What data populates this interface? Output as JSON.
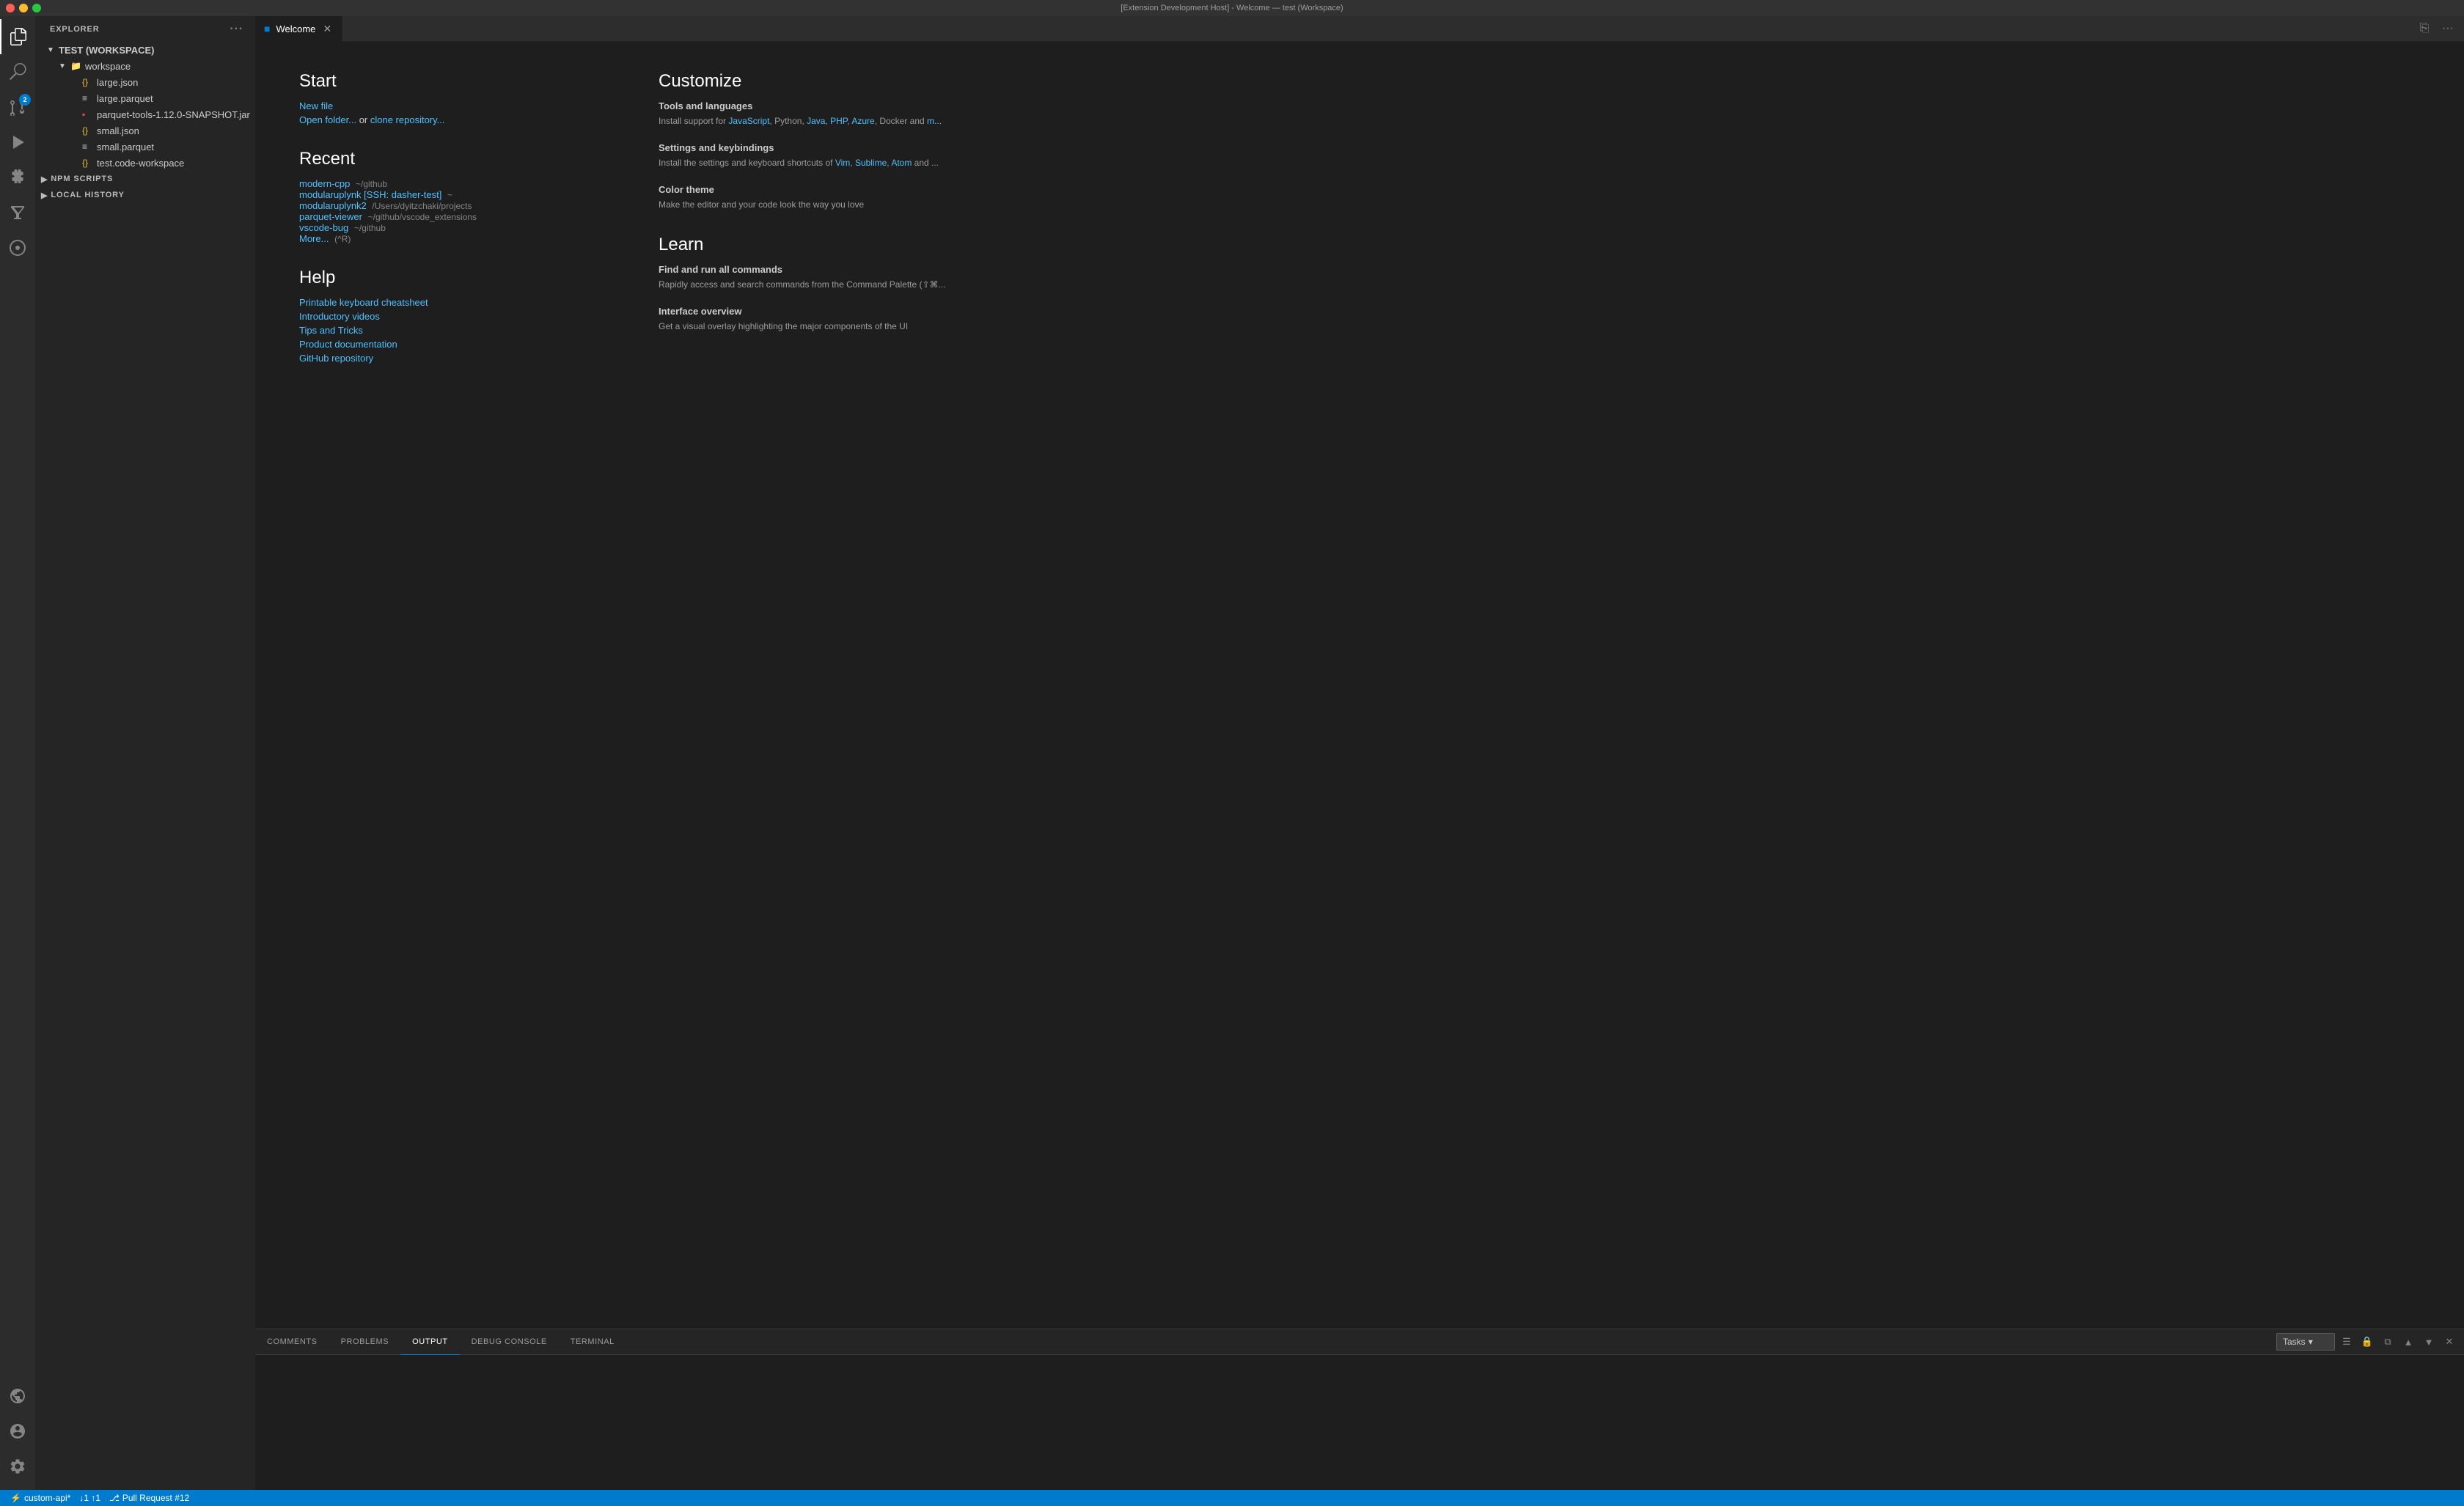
{
  "titlebar": {
    "title": "[Extension Development Host] - Welcome — test (Workspace)"
  },
  "activitybar": {
    "icons": [
      {
        "name": "explorer-icon",
        "symbol": "⎗",
        "active": true,
        "badge": null
      },
      {
        "name": "search-icon",
        "symbol": "🔍",
        "active": false,
        "badge": null
      },
      {
        "name": "source-control-icon",
        "symbol": "⎇",
        "active": false,
        "badge": "2"
      },
      {
        "name": "run-icon",
        "symbol": "▷",
        "active": false,
        "badge": null
      },
      {
        "name": "extensions-icon",
        "symbol": "⊞",
        "active": false,
        "badge": null
      },
      {
        "name": "testing-icon",
        "symbol": "⚗",
        "active": false,
        "badge": null
      },
      {
        "name": "git-graph-icon",
        "symbol": "◎",
        "active": false,
        "badge": null
      },
      {
        "name": "remote-icon",
        "symbol": "⊕",
        "active": false,
        "badge": null
      }
    ],
    "bottom": [
      {
        "name": "account-icon",
        "symbol": "👤"
      },
      {
        "name": "settings-icon",
        "symbol": "⚙"
      }
    ]
  },
  "sidebar": {
    "title": "EXPLORER",
    "workspace": {
      "label": "TEST (WORKSPACE)",
      "children": [
        {
          "label": "workspace",
          "expanded": true,
          "children": [
            {
              "label": "large.json",
              "type": "json"
            },
            {
              "label": "large.parquet",
              "type": "parquet"
            },
            {
              "label": "parquet-tools-1.12.0-SNAPSHOT.jar",
              "type": "jar"
            },
            {
              "label": "small.json",
              "type": "json"
            },
            {
              "label": "small.parquet",
              "type": "parquet"
            },
            {
              "label": "test.code-workspace",
              "type": "workspace"
            }
          ]
        }
      ]
    },
    "sections": [
      {
        "label": "NPM SCRIPTS"
      },
      {
        "label": "LOCAL HISTORY"
      }
    ]
  },
  "tabs": [
    {
      "label": "Welcome",
      "active": true,
      "icon": "vscode-icon",
      "closeable": true
    }
  ],
  "welcome": {
    "start": {
      "heading": "Start",
      "links": [
        {
          "label": "New file",
          "sub": ""
        },
        {
          "label": "Open folder...",
          "sub": " or "
        },
        {
          "label": "clone repository...",
          "sub": ""
        }
      ]
    },
    "recent": {
      "heading": "Recent",
      "items": [
        {
          "label": "modern-cpp",
          "sub": "~/github"
        },
        {
          "label": "modularuplynk [SSH: dasher-test]",
          "sub": "~"
        },
        {
          "label": "modularuplynk2",
          "sub": "/Users/dyitzchaki/projects"
        },
        {
          "label": "parquet-viewer",
          "sub": "~/github/vscode_extensions"
        },
        {
          "label": "vscode-bug",
          "sub": "~/github"
        },
        {
          "label": "More...",
          "shortcut": "(^R)"
        }
      ]
    },
    "help": {
      "heading": "Help",
      "links": [
        {
          "label": "Printable keyboard cheatsheet"
        },
        {
          "label": "Introductory videos"
        },
        {
          "label": "Tips and Tricks"
        },
        {
          "label": "Product documentation"
        },
        {
          "label": "GitHub repository"
        }
      ]
    },
    "customize": {
      "heading": "Customize",
      "items": [
        {
          "title": "Tools and languages",
          "description": "Install support for ",
          "links": [
            "JavaScript",
            "Python, ",
            "Java",
            "PHP",
            "Azure",
            "Docker and "
          ],
          "more": "m..."
        },
        {
          "title": "Settings and keybindings",
          "description": "Install the settings and keyboard shortcuts of ",
          "links": [
            "Vim",
            "Sublime",
            "Atom"
          ],
          "more": " and ..."
        },
        {
          "title": "Color theme",
          "description": "Make the editor and your code look the way you love"
        }
      ]
    },
    "learn": {
      "heading": "Learn",
      "items": [
        {
          "title": "Find and run all commands",
          "description": "Rapidly access and search commands from the Command Palette (⇧⌘..."
        },
        {
          "title": "Interface overview",
          "description": "Get a visual overlay highlighting the major components of the UI"
        }
      ]
    }
  },
  "panel": {
    "tabs": [
      {
        "label": "COMMENTS",
        "active": false
      },
      {
        "label": "PROBLEMS",
        "active": false
      },
      {
        "label": "OUTPUT",
        "active": true
      },
      {
        "label": "DEBUG CONSOLE",
        "active": false
      },
      {
        "label": "TERMINAL",
        "active": false
      }
    ],
    "dropdown_value": "Tasks"
  },
  "statusbar": {
    "left": [
      {
        "label": "⚡ custom-api*",
        "name": "branch-item"
      },
      {
        "label": "↓1 ↑1",
        "name": "sync-item"
      },
      {
        "label": " Pull Request #12",
        "name": "pr-item"
      }
    ]
  }
}
